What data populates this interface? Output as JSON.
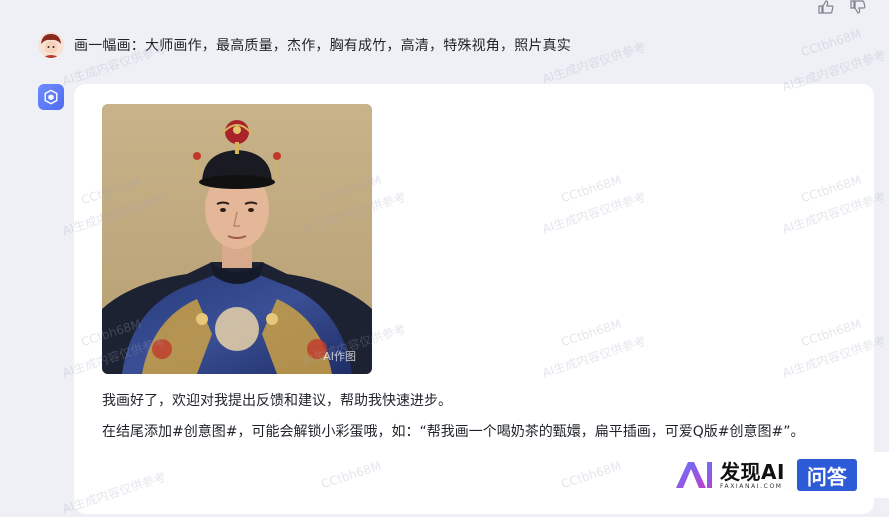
{
  "conversation": {
    "user_prompt": "画一幅画：大师画作，最高质量，杰作，胸有成竹，高清，特殊视角，照片真实",
    "reply_line1": "我画好了，欢迎对我提出反馈和建议，帮助我快速进步。",
    "reply_line2": "在结尾添加#创意图#，可能会解锁小彩蛋哦，如：“帮我画一个喝奶茶的甄嬛，扁平插画，可爱Q版#创意图#”。",
    "image_watermark": "AI作图"
  },
  "watermark": {
    "line1": "CCtbh68M",
    "line2": "AI生成内容仅供参考"
  },
  "brand": {
    "name": "发现AI",
    "sub": "FAXIANAI.COM",
    "badge": "问答"
  },
  "icons": {
    "like": "thumbs-up-icon",
    "dislike": "thumbs-down-icon",
    "bot": "bot-cube-icon"
  }
}
